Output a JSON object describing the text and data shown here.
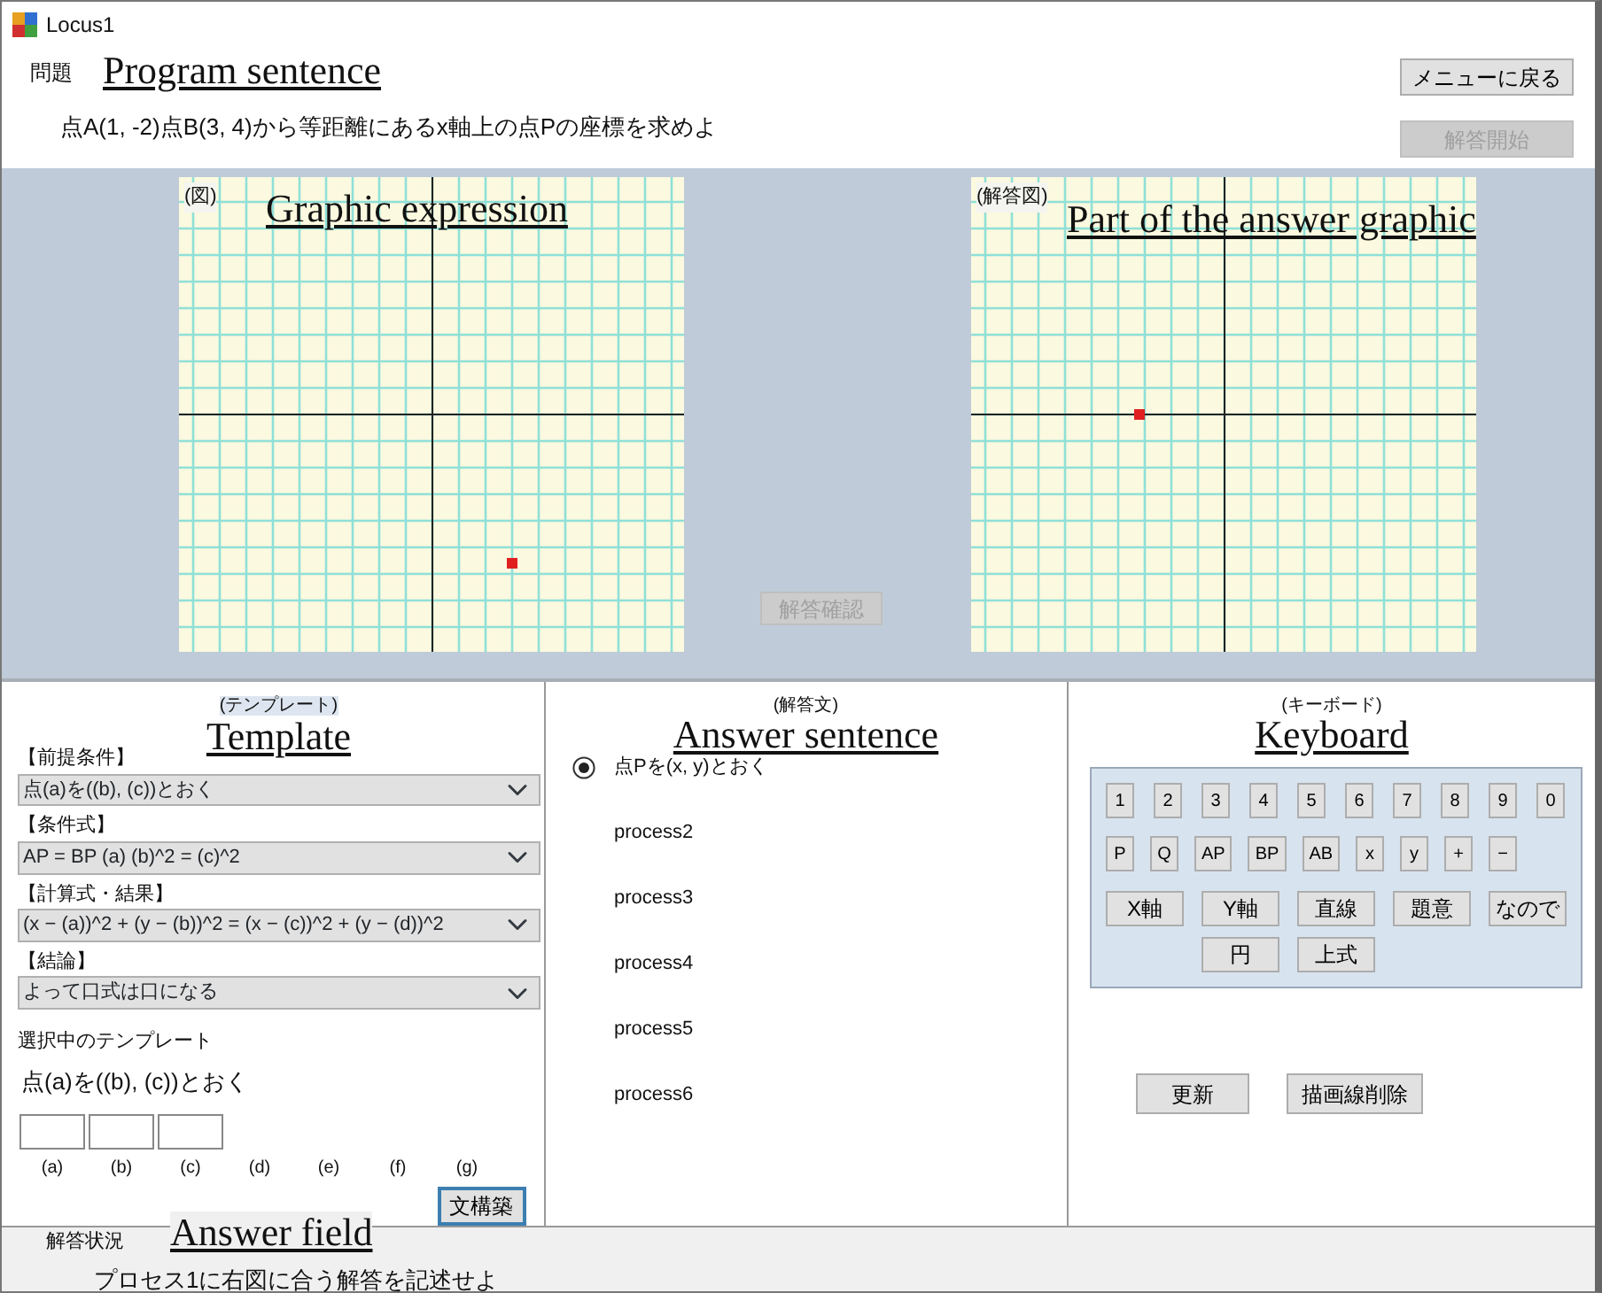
{
  "window": {
    "title": "Locus1"
  },
  "problem": {
    "label": "問題",
    "annotation": "Program sentence",
    "sentence": "点A(1, -2)点B(3, 4)から等距離にあるx軸上の点Pの座標を求めよ",
    "buttons": [
      {
        "label": "メニューに戻る",
        "disabled": false
      },
      {
        "label": "解答開始",
        "disabled": true
      }
    ]
  },
  "graphs": [
    {
      "label": "(図)",
      "annotation": "Graphic expression"
    },
    {
      "label": "(解答図)",
      "annotation": "Part of the answer graphic"
    }
  ],
  "check_button": {
    "label": "解答確認",
    "disabled": true
  },
  "template": {
    "heading": "(テンプレート)",
    "annotation": "Template",
    "sections": [
      {
        "label": "【前提条件】",
        "value": "点(a)を((b), (c))とおく"
      },
      {
        "label": "【条件式】",
        "value": "AP = BP  (a)  (b)^2 = (c)^2"
      },
      {
        "label": "【計算式・結果】",
        "value": "(x − (a))^2 + (y − (b))^2 = (x − (c))^2 + (y − (d))^2"
      },
      {
        "label": "【結論】",
        "value": "よって口式は口になる"
      }
    ],
    "selected_label": "選択中のテンプレート",
    "selected_text": "点(a)を((b), (c))とおく",
    "slots": [
      {
        "letter": "(a)",
        "field": true
      },
      {
        "letter": "(b)",
        "field": true
      },
      {
        "letter": "(c)",
        "field": true
      },
      {
        "letter": "(d)",
        "field": false
      },
      {
        "letter": "(e)",
        "field": false
      },
      {
        "letter": "(f)",
        "field": false
      },
      {
        "letter": "(g)",
        "field": false
      }
    ],
    "build_button": "文構築"
  },
  "answer": {
    "heading": "(解答文)",
    "annotation": "Answer sentence",
    "processes": [
      {
        "text": "点Pを(x, y)とおく",
        "selected": true
      },
      {
        "text": "process2",
        "selected": false
      },
      {
        "text": "process3",
        "selected": false
      },
      {
        "text": "process4",
        "selected": false
      },
      {
        "text": "process5",
        "selected": false
      },
      {
        "text": "process6",
        "selected": false
      }
    ]
  },
  "keyboard": {
    "heading": "(キーボード)",
    "annotation": "Keyboard",
    "number_keys": [
      "1",
      "2",
      "3",
      "4",
      "5",
      "6",
      "7",
      "8",
      "9",
      "0"
    ],
    "symbol_keys": [
      "P",
      "Q",
      "AP",
      "BP",
      "AB",
      "x",
      "y",
      "+",
      "−"
    ],
    "word_keys": [
      "X軸",
      "Y軸",
      "直線",
      "題意",
      "なので",
      "円",
      "上式"
    ],
    "buttons": [
      "更新",
      "描画線削除"
    ]
  },
  "status": {
    "label": "解答状況",
    "annotation": "Answer field",
    "message": "プロセス1に右図に合う解答を記述せよ"
  }
}
